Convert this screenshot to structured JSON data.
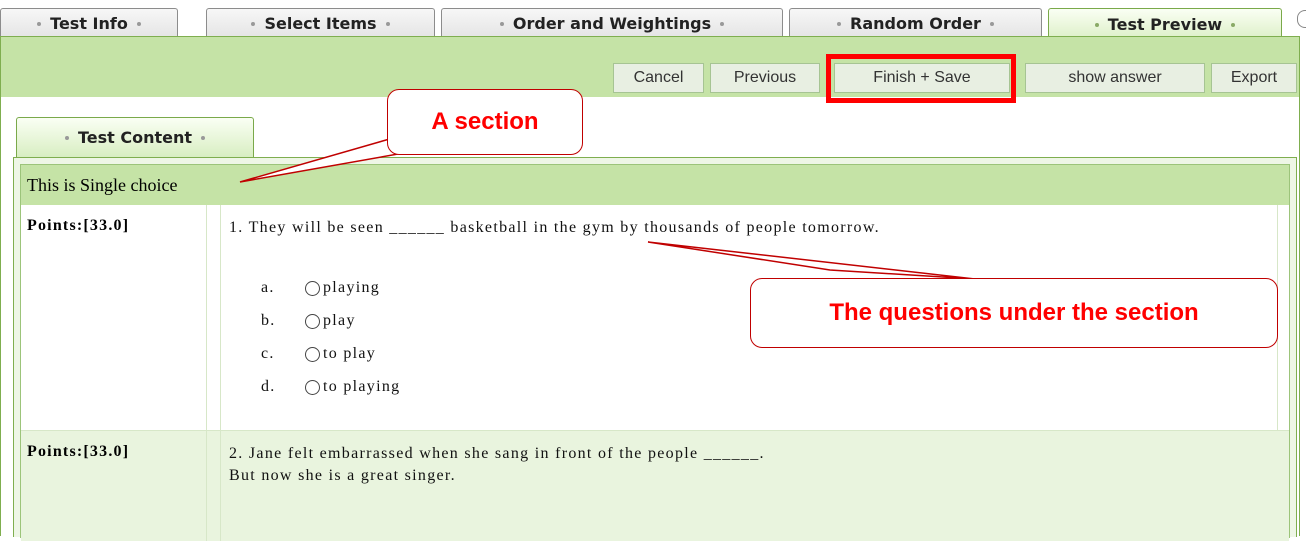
{
  "tabs": [
    {
      "label": "Test Info",
      "active": false
    },
    {
      "label": "Select Items",
      "active": false
    },
    {
      "label": "Order and Weightings",
      "active": false
    },
    {
      "label": "Random Order",
      "active": false
    },
    {
      "label": "Test Preview",
      "active": true
    }
  ],
  "toolbar": {
    "cancel_label": "Cancel",
    "previous_label": "Previous",
    "finish_save_label": "Finish + Save",
    "show_answer_label": "show answer",
    "export_label": "Export"
  },
  "content_tab": {
    "label": "Test Content"
  },
  "section": {
    "title": "This is Single choice"
  },
  "questions": [
    {
      "points": "Points:[33.0]",
      "text": "1. They will be seen ______ basketball in the gym by thousands of people tomorrow.",
      "options": [
        {
          "letter": "a.",
          "text": "playing"
        },
        {
          "letter": "b.",
          "text": "play"
        },
        {
          "letter": "c.",
          "text": "to play"
        },
        {
          "letter": "d.",
          "text": "to playing"
        }
      ]
    },
    {
      "points": "Points:[33.0]",
      "text": "2. Jane felt embarrassed when she sang in front of the people ______.\nBut now she is a great singer."
    }
  ],
  "annotations": {
    "section_callout": "A section",
    "questions_callout": "The questions under the section"
  },
  "colors": {
    "highlight_box": "#ff0000",
    "toolbar_bg": "#c5e3a6",
    "frame_border": "#7fae4f"
  }
}
